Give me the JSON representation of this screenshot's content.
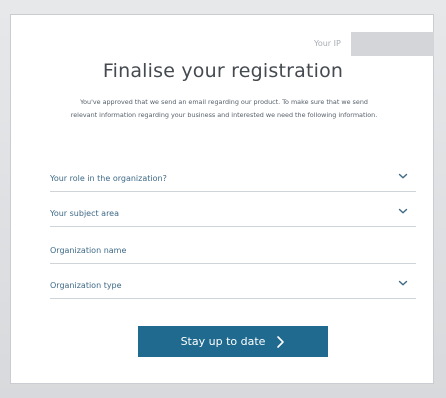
{
  "page": {
    "ip_label": "Your IP",
    "title": "Finalise your registration",
    "intro_line_1": "You've approved that we send an email regarding our product. To make sure that we send",
    "intro_line_2": "relevant information regarding your business and interested we need the following information."
  },
  "form": {
    "fields": [
      {
        "label": "Your role in the organization?",
        "type": "dropdown",
        "icon": "chevron-down-icon"
      },
      {
        "label": "Your subject area",
        "type": "dropdown",
        "icon": "chevron-down-icon"
      },
      {
        "label": "Organization name",
        "type": "text"
      },
      {
        "label": "Organization type",
        "type": "dropdown",
        "icon": "chevron-down-icon"
      }
    ],
    "submit_label": "Stay up to date",
    "submit_icon": "chevron-right-icon"
  },
  "colors": {
    "accent": "#1f6a8e",
    "label_blue": "#3e6a87",
    "title": "#444a50",
    "divider": "#cfd4d8"
  }
}
